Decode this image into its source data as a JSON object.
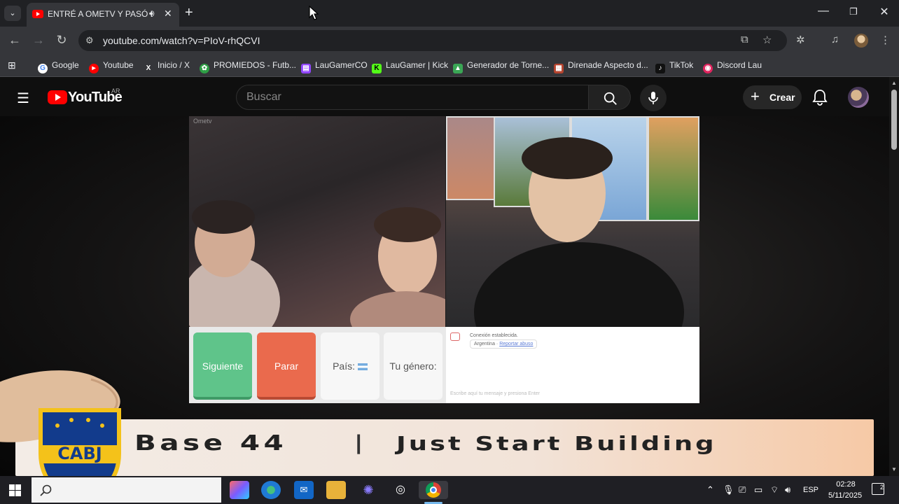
{
  "browser": {
    "tab_title": "ENTRÉ A OMETV Y PASÓ ES",
    "url": "youtube.com/watch?v=PIoV-rhQCVI",
    "window_controls": {
      "minimize": "—",
      "restore": "❐",
      "close": "✕"
    }
  },
  "bookmarks": [
    {
      "label": "Google",
      "icon": "google-icon",
      "color": "#4285f4"
    },
    {
      "label": "Youtube",
      "icon": "youtube-icon",
      "color": "#ff0000"
    },
    {
      "label": "Inicio / X",
      "icon": "x-icon",
      "color": "#000000"
    },
    {
      "label": "PROMIEDOS - Futb...",
      "icon": "promiedos-icon",
      "color": "#2e9e45"
    },
    {
      "label": "LauGamerCO",
      "icon": "twitch-icon",
      "color": "#9146ff"
    },
    {
      "label": "LauGamer | Kick",
      "icon": "kick-icon",
      "color": "#53fc18"
    },
    {
      "label": "Generador de Torne...",
      "icon": "generator-icon",
      "color": "#3aa655"
    },
    {
      "label": "Direnade Aspecto d...",
      "icon": "direnade-icon",
      "color": "#b5442f"
    },
    {
      "label": "TikTok",
      "icon": "tiktok-icon",
      "color": "#000000"
    },
    {
      "label": "Discord Lau",
      "icon": "discord-icon",
      "color": "#e0245e"
    }
  ],
  "youtube": {
    "logo_text": "YouTube",
    "country": "AR",
    "search_placeholder": "Buscar",
    "create_label": "Crear"
  },
  "video": {
    "ometv_brand": "Ometv",
    "buttons": {
      "next": "Siguiente",
      "stop": "Parar",
      "country": "País: ",
      "gender": "Tu género: "
    },
    "chat": {
      "system_message": "Conexión establecida.",
      "country_line": "Argentina",
      "report_link": "Reportar abuso",
      "input_hint": "Escribe aquí tu mensaje y presiona Enter"
    },
    "banner": {
      "left_text": "Base 44",
      "separator": "|",
      "right_text": "Just Start Building"
    },
    "crest_text": "CABJ"
  },
  "taskbar": {
    "language": "ESP",
    "time": "02:28",
    "date": "5/11/2025",
    "notifications": "2"
  }
}
